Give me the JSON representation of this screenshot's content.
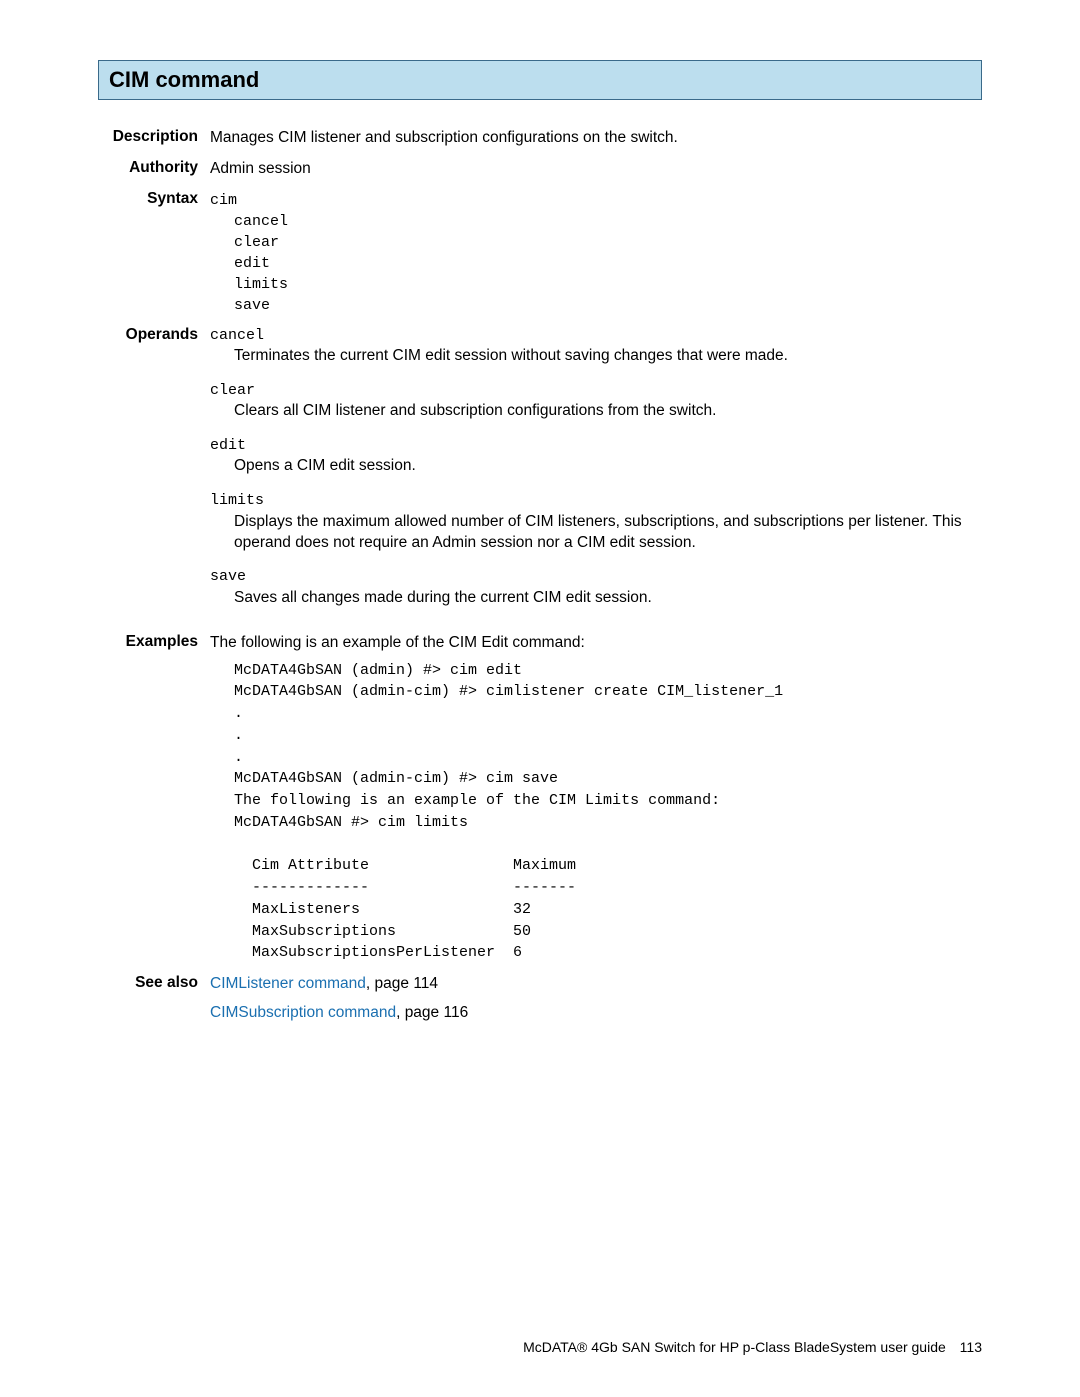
{
  "title": "CIM command",
  "description": {
    "label": "Description",
    "text": "Manages CIM listener and subscription configurations on the switch."
  },
  "authority": {
    "label": "Authority",
    "text": "Admin session"
  },
  "syntax": {
    "label": "Syntax",
    "command": "cim",
    "args": [
      "cancel",
      "clear",
      "edit",
      "limits",
      "save"
    ]
  },
  "operands": {
    "label": "Operands",
    "items": [
      {
        "name": "cancel",
        "desc": "Terminates the current CIM edit session without saving changes that were made."
      },
      {
        "name": "clear",
        "desc": "Clears all CIM listener and subscription configurations from the switch."
      },
      {
        "name": "edit",
        "desc": "Opens a CIM edit session."
      },
      {
        "name": "limits",
        "desc": "Displays the maximum allowed number of CIM listeners, subscriptions, and subscriptions per listener. This operand does not require an Admin session nor a CIM edit session."
      },
      {
        "name": "save",
        "desc": "Saves all changes made during the current CIM edit session."
      }
    ]
  },
  "examples": {
    "label": "Examples",
    "intro": "The following is an example of the CIM Edit command:",
    "code": "McDATA4GbSAN (admin) #> cim edit\nMcDATA4GbSAN (admin-cim) #> cimlistener create CIM_listener_1\n.\n.\n.\nMcDATA4GbSAN (admin-cim) #> cim save\nThe following is an example of the CIM Limits command:\nMcDATA4GbSAN #> cim limits\n\n  Cim Attribute                Maximum\n  -------------                -------\n  MaxListeners                 32\n  MaxSubscriptions             50\n  MaxSubscriptionsPerListener  6"
  },
  "seealso": {
    "label": "See also",
    "items": [
      {
        "link": "CIMListener command",
        "suffix": ", page 114"
      },
      {
        "link": "CIMSubscription command",
        "suffix": ", page 116"
      }
    ]
  },
  "footer": {
    "text": "McDATA® 4Gb SAN Switch for HP p-Class BladeSystem user guide",
    "page": "113"
  }
}
